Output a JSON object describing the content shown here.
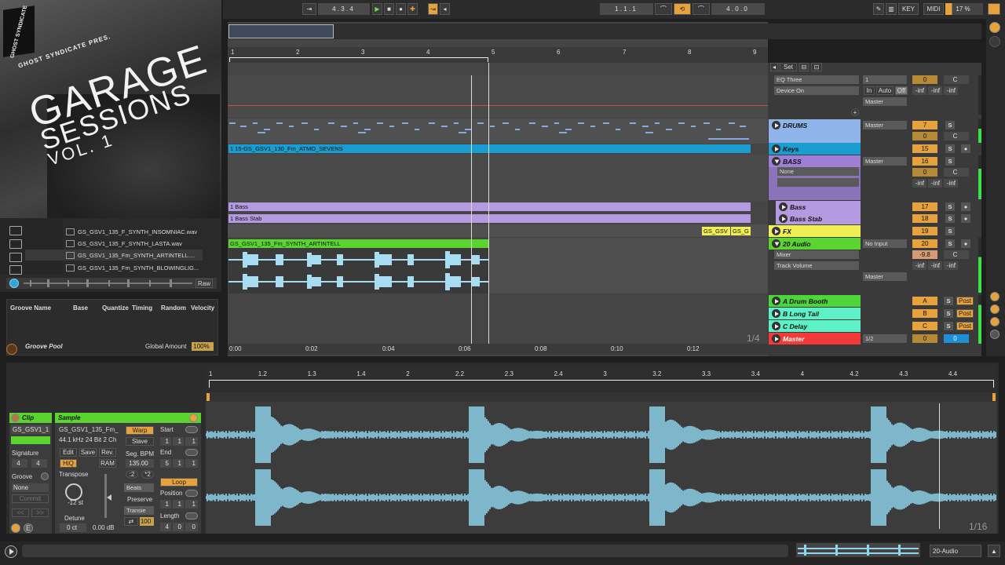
{
  "transport": {
    "position": "4 . 3 . 4",
    "loop_start": "1 . 1 . 1",
    "loop_length": "4 . 0 . 0",
    "key_label": "KEY",
    "midi_label": "MIDI",
    "cpu": "17 %"
  },
  "cover": {
    "brand": "GHOST SYNDICATE",
    "presents": "GHOST SYNDICATE PRES.",
    "line1": "GARAGE",
    "line2": "SESSIONS",
    "line3": "VOL. 1"
  },
  "browser": {
    "files": [
      "GS_GSV1_135_F_SYNTH_INSOMNIAC.wav",
      "GS_GSV1_135_F_SYNTH_LASTA.wav",
      "GS_GSV1_135_Fm_SYNTH_ARTINTELL....",
      "GS_GSV1_135_Fm_SYNTH_BLOWINGLIG..."
    ],
    "raw_label": "Raw"
  },
  "groove": {
    "headers": [
      "Groove Name",
      "Base",
      "Quantize",
      "Timing",
      "Random",
      "Velocity"
    ],
    "pool_label": "Groove Pool",
    "global_label": "Global Amount",
    "global_value": "100%"
  },
  "arrangement": {
    "bars": [
      "1",
      "2",
      "3",
      "4",
      "5",
      "6",
      "7",
      "8",
      "9"
    ],
    "times": [
      "0:00",
      "0:02",
      "0:04",
      "0:06",
      "0:08",
      "0:10",
      "0:12"
    ],
    "zoom": "1/4",
    "clips": {
      "atmo": "1 15-GS_GSV1_130_Fm_ATMO_SEVENS",
      "bass": "1 Bass",
      "bass_stab": "1 Bass Stab",
      "fx1": "GS_GSV",
      "fx2": "GS_G",
      "audio": "GS_GSV1_135_Fm_SYNTH_ARTINTELL"
    }
  },
  "mixer": {
    "set_label": "Set",
    "eq_device": "EQ Three",
    "device_on": "Device On",
    "top_in": "1",
    "in_label": "In",
    "auto_label": "Auto",
    "off_label": "Off",
    "master": "Master",
    "none": "None",
    "no_input": "No Input",
    "mixer_label": "Mixer",
    "track_volume": "Track Volume",
    "inf": "-inf",
    "c": "C",
    "zero": "0",
    "neg98": "-9.8",
    "half": "1/2",
    "tracks": [
      {
        "name": "DRUMS",
        "num": "7",
        "color": "#8fb4ea"
      },
      {
        "name": "Keys",
        "num": "15",
        "color": "#1a9dd1"
      },
      {
        "name": "BASS",
        "num": "16",
        "color": "#9e7fd6"
      },
      {
        "name": "Bass",
        "num": "17",
        "color": "#b49ae0"
      },
      {
        "name": "Bass Stab",
        "num": "18",
        "color": "#b49ae0"
      },
      {
        "name": "FX",
        "num": "19",
        "color": "#f0ee55"
      },
      {
        "name": "20 Audio",
        "num": "20",
        "color": "#5ad42e"
      },
      {
        "name": "A Drum Booth",
        "num": "A",
        "color": "#4ed53c"
      },
      {
        "name": "B Long Tail",
        "num": "B",
        "color": "#5ef0c6"
      },
      {
        "name": "C Delay",
        "num": "C",
        "color": "#5ef0c6"
      },
      {
        "name": "Master",
        "num": "0",
        "color": "#f23a3a"
      }
    ],
    "post": "Post",
    "s": "S"
  },
  "clip_view": {
    "clip_title": "Clip",
    "sample_title": "Sample",
    "clip_name": "GS_GSV1_1",
    "sample_name": "GS_GSV1_135_Fm_",
    "sample_info": "44.1 kHz 24 Bit 2 Ch",
    "signature_label": "Signature",
    "sig_num": "4",
    "sig_den": "4",
    "groove_label": "Groove",
    "groove_value": "None",
    "commit": "Commit",
    "edit": "Edit",
    "save": "Save",
    "rev": "Rev.",
    "hiq": "HiQ",
    "ram": "RAM",
    "warp": "Warp",
    "slave": "Slave",
    "seg_bpm_label": "Seg. BPM",
    "seg_bpm": "135.00",
    "half": ":2",
    "double": "*2",
    "beats": "Beats",
    "preserve": "Preserve",
    "transients": "Transie",
    "transient_val": "100",
    "transpose_label": "Transpose",
    "transpose_value": "-12 st",
    "detune_label": "Detune",
    "detune_value": "0 ct",
    "volume_value": "0.00 dB",
    "start_label": "Start",
    "end_label": "End",
    "loop_label": "Loop",
    "position_label": "Position",
    "length_label": "Length",
    "start_vals": [
      "1",
      "1",
      "1"
    ],
    "end_vals": [
      "5",
      "1",
      "1"
    ],
    "pos_vals": [
      "1",
      "1",
      "1"
    ],
    "len_vals": [
      "4",
      "0",
      "0"
    ],
    "ruler": [
      "1",
      "1.2",
      "1.3",
      "1.4",
      "2",
      "2.2",
      "2.3",
      "2.4",
      "3",
      "3.2",
      "3.3",
      "3.4",
      "4",
      "4.2",
      "4.3",
      "4.4"
    ],
    "zoom": "1/16"
  },
  "status": {
    "track": "20-Audio"
  },
  "colors": {
    "accent_orange": "#e6a23c",
    "green": "#5ad42e",
    "waveform": "#8fd6ef"
  }
}
